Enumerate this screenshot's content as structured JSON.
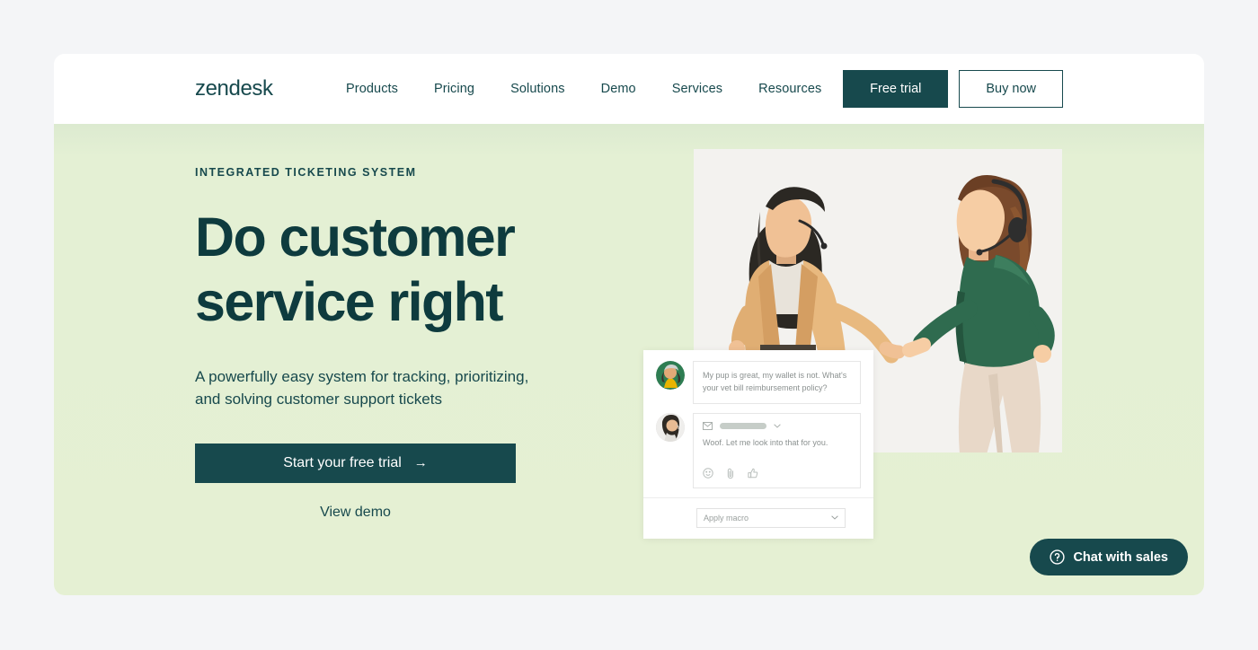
{
  "brand": {
    "logo_text": "zendesk",
    "accent_dark": "#17494d",
    "hero_bg": "#e5f0d3",
    "page_bg": "#f4f5f7"
  },
  "nav": {
    "links": [
      {
        "label": "Products"
      },
      {
        "label": "Pricing"
      },
      {
        "label": "Solutions"
      },
      {
        "label": "Demo"
      },
      {
        "label": "Services"
      },
      {
        "label": "Resources"
      }
    ],
    "free_trial_label": "Free trial",
    "buy_now_label": "Buy now"
  },
  "hero": {
    "eyebrow": "INTEGRATED TICKETING SYSTEM",
    "title_line1": "Do customer",
    "title_line2": "service right",
    "subtitle": "A powerfully easy system for tracking, prioritizing, and solving customer support tickets",
    "cta_primary": "Start your free trial",
    "cta_primary_arrow": "→",
    "cta_secondary": "View demo",
    "photo_alt": "two-agents-relay-baton-photo"
  },
  "chat_widget": {
    "messages": [
      {
        "author": "customer",
        "avatar": "customer-avatar",
        "text": "My pup is great, my wallet is not. What's your vet bill reimbursement policy?"
      },
      {
        "author": "agent",
        "avatar": "agent-avatar",
        "channel_icon": "envelope-icon",
        "channel_value_redacted": true,
        "text": "Woof. Let me look into that for you.",
        "actions": [
          "emoji-icon",
          "attachment-icon",
          "thumbs-up-icon"
        ]
      }
    ],
    "macro_placeholder": "Apply macro",
    "macro_chevron": "chevron-down-icon"
  },
  "chat_sales": {
    "label": "Chat with sales",
    "icon": "question-mark-circle-icon"
  }
}
